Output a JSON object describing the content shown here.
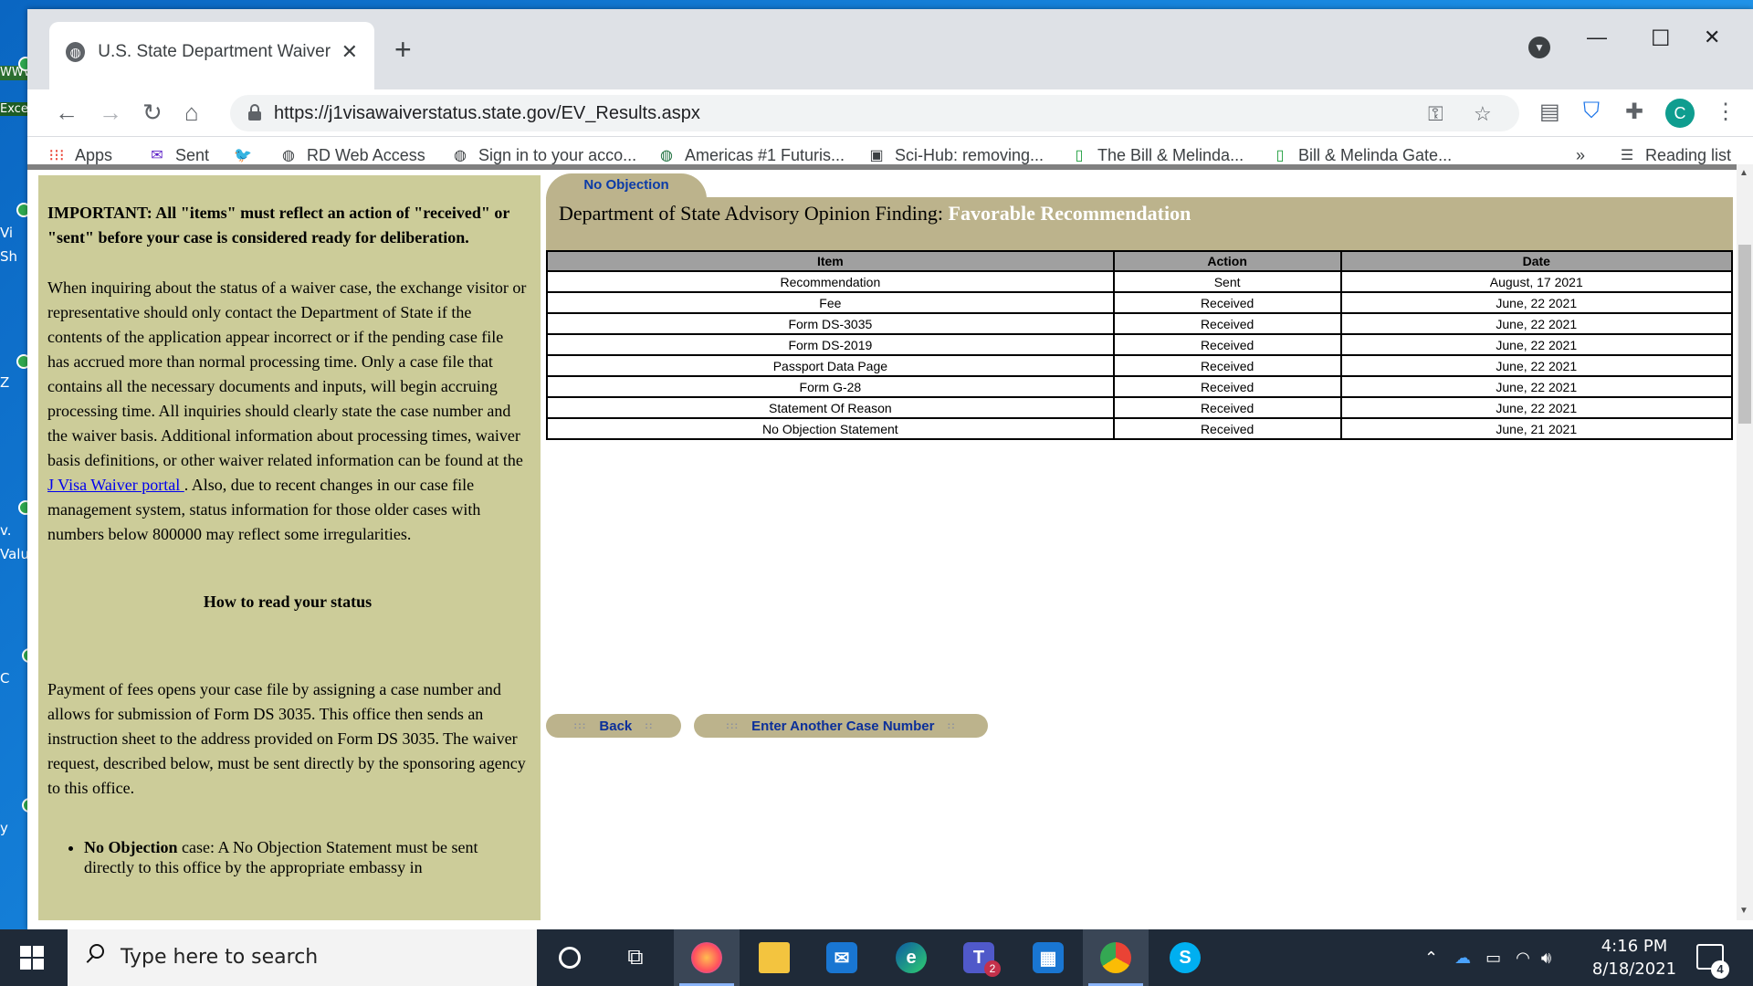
{
  "desktop": {
    "icons": [
      "WWW",
      "Exce",
      "Vi",
      "Sh",
      "Z",
      "v.",
      "Valu",
      "C",
      "y"
    ]
  },
  "browser": {
    "tab_title": "U.S. State Department Waiver Sys",
    "tab_close": "✕",
    "new_tab": "+",
    "window_controls": {
      "minimize": "—",
      "maximize": "☐",
      "close": "✕"
    },
    "url": "https://j1visawaiverstatus.state.gov/EV_Results.aspx",
    "profile_initial": "C",
    "bookmarks": [
      {
        "label": "Apps",
        "icon": "apps-grid-icon"
      },
      {
        "label": "Sent",
        "icon": "mail-icon"
      },
      {
        "label": "",
        "icon": "twitter-icon"
      },
      {
        "label": "RD Web Access",
        "icon": "globe-icon"
      },
      {
        "label": "Sign in to your acco...",
        "icon": "globe-icon"
      },
      {
        "label": "Americas #1 Futuris...",
        "icon": "globe-icon"
      },
      {
        "label": "Sci-Hub: removing...",
        "icon": "bookmark-icon"
      },
      {
        "label": "The Bill & Melinda...",
        "icon": "bookmark-icon"
      },
      {
        "label": "Bill & Melinda Gate...",
        "icon": "bookmark-icon"
      }
    ],
    "more_bookmarks": "»",
    "reading_list": "Reading list"
  },
  "sidebar": {
    "important": "IMPORTANT: All \"items\" must reflect an action of \"received\" or \"sent\" before your case is considered ready for deliberation.",
    "para1_before_link": "When inquiring about the status of a waiver case, the exchange visitor or representative should only contact the Department of State if the contents of the application appear incorrect or if the pending case file has accrued more than normal processing time. Only a case file that contains all the necessary documents and inputs, will begin accruing processing time. All inquiries should clearly state the case number and the waiver basis.   Additional information about processing times, waiver basis definitions, or other waiver related information can be found at the ",
    "para1_link": "J Visa Waiver portal ",
    "para1_after_link": ". Also, due to recent changes in our case file management system, status information for those older cases with numbers below 800000 may reflect some irregularities.",
    "how_to_heading": "How to read your status",
    "para2": "Payment of fees opens your case file by assigning a case number and allows for submission of Form DS 3035.  This office then sends an instruction sheet to the address provided on Form DS 3035.  The waiver request, described below, must be sent directly by the sponsoring agency to this office.",
    "bullet_bold": "No Objection",
    "bullet_text": " case: A No Objection Statement must be sent directly to this office by the appropriate embassy in"
  },
  "main": {
    "basis_tab": "No Objection",
    "finding_prefix": "Department of State Advisory Opinion Finding: ",
    "finding_value": "Favorable Recommendation",
    "table": {
      "headers": [
        "Item",
        "Action",
        "Date"
      ],
      "rows": [
        [
          "Recommendation",
          "Sent",
          "August, 17 2021"
        ],
        [
          "Fee",
          "Received",
          "June, 22 2021"
        ],
        [
          "Form DS-3035",
          "Received",
          "June, 22 2021"
        ],
        [
          "Form DS-2019",
          "Received",
          "June, 22 2021"
        ],
        [
          "Passport Data Page",
          "Received",
          "June, 22 2021"
        ],
        [
          "Form G-28",
          "Received",
          "June, 22 2021"
        ],
        [
          "Statement Of Reason",
          "Received",
          "June, 22 2021"
        ],
        [
          "No Objection Statement",
          "Received",
          "June, 21 2021"
        ]
      ]
    },
    "back_button": "Back",
    "another_case_button": "Enter Another Case Number"
  },
  "taskbar": {
    "search_placeholder": "Type here to search",
    "teams_badge": "2",
    "time": "4:16 PM",
    "date": "8/18/2021",
    "notification_count": "4"
  },
  "colors": {
    "sidebar_bg": "#cccc99",
    "finding_bar": "#bcb38c",
    "link_blue": "#0000ee",
    "button_text": "#0b2f9a"
  }
}
